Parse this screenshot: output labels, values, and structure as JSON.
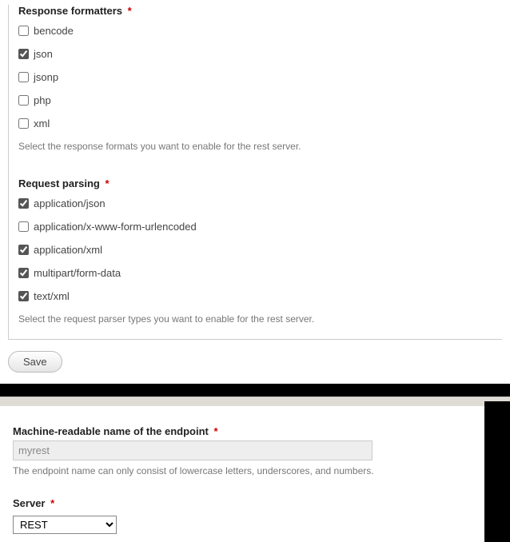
{
  "response_formatters": {
    "title": "Response formatters",
    "options": [
      {
        "label": "bencode",
        "checked": false
      },
      {
        "label": "json",
        "checked": true
      },
      {
        "label": "jsonp",
        "checked": false
      },
      {
        "label": "php",
        "checked": false
      },
      {
        "label": "xml",
        "checked": false
      }
    ],
    "help": "Select the response formats you want to enable for the rest server."
  },
  "request_parsing": {
    "title": "Request parsing",
    "options": [
      {
        "label": "application/json",
        "checked": true
      },
      {
        "label": "application/x-www-form-urlencoded",
        "checked": false
      },
      {
        "label": "application/xml",
        "checked": true
      },
      {
        "label": "multipart/form-data",
        "checked": true
      },
      {
        "label": "text/xml",
        "checked": true
      }
    ],
    "help": "Select the request parser types you want to enable for the rest server."
  },
  "save_label": "Save",
  "endpoint_name": {
    "label": "Machine-readable name of the endpoint",
    "value": "myrest",
    "help": "The endpoint name can only consist of lowercase letters, underscores, and numbers."
  },
  "server": {
    "label": "Server",
    "selected": "REST",
    "options": [
      "REST"
    ]
  },
  "required_mark": "*"
}
